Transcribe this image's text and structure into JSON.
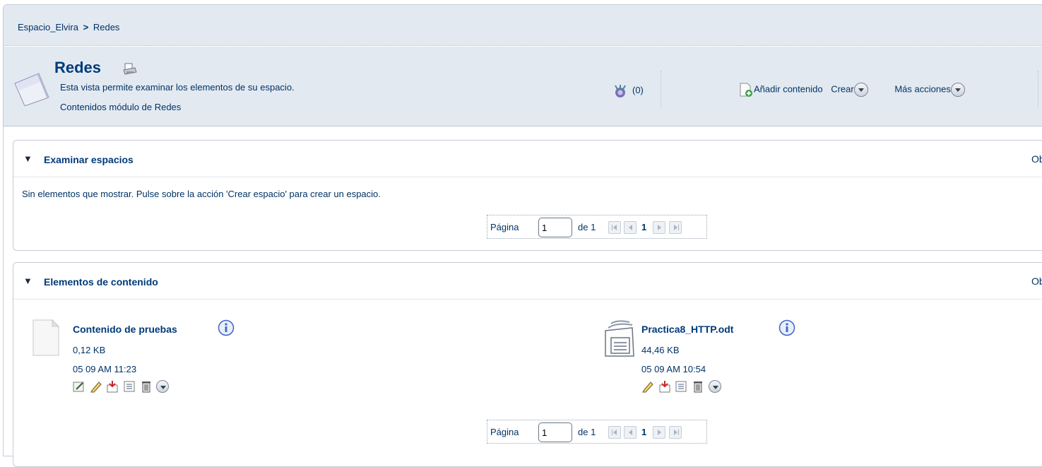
{
  "breadcrumb": {
    "parent": "Espacio_Elvira",
    "separator": ">",
    "current": "Redes"
  },
  "header": {
    "title": "Redes",
    "description_line1": "Esta vista permite examinar los elementos de su espacio.",
    "description_line2": "Contenidos módulo de Redes",
    "count": "(0)",
    "actions": {
      "add_content": "Añadir contenido",
      "create": "Crear",
      "more_actions": "Más acciones"
    }
  },
  "spaces_panel": {
    "title": "Examinar espacios",
    "options": "Ob",
    "empty_message": "Sin elementos que mostrar. Pulse sobre la acción 'Crear espacio' para crear un espacio.",
    "pager": {
      "label": "Página",
      "value": "1",
      "of": "de 1",
      "current": "1"
    }
  },
  "content_panel": {
    "title": "Elementos de contenido",
    "options": "Ob",
    "items": [
      {
        "name": "Contenido de pruebas",
        "size": "0,12 KB",
        "date": "05 09 AM 11:23",
        "icon": "blank-document-icon"
      },
      {
        "name": "Practica8_HTTP.odt",
        "size": "44,46 KB",
        "date": "05 09 AM 10:54",
        "icon": "odt-document-icon"
      }
    ],
    "pager": {
      "label": "Página",
      "value": "1",
      "of": "de 1",
      "current": "1"
    }
  },
  "colors": {
    "header_bg": "#e3e9f1",
    "text": "#003366",
    "title": "#003a7a"
  }
}
